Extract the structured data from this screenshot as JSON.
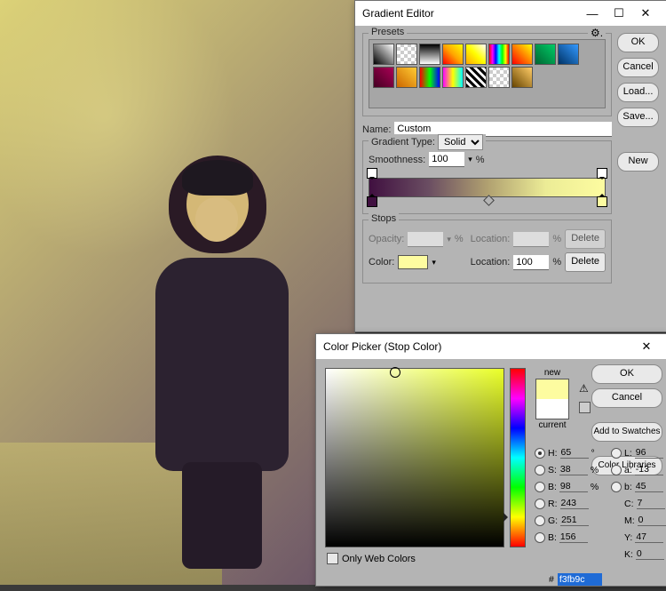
{
  "gradient_editor": {
    "title": "Gradient Editor",
    "buttons": {
      "ok": "OK",
      "cancel": "Cancel",
      "load": "Load...",
      "save": "Save...",
      "new": "New"
    },
    "presets_label": "Presets",
    "name_label": "Name:",
    "name_value": "Custom",
    "type_group": "Gradient Type:",
    "type_value": "Solid",
    "smoothness_label": "Smoothness:",
    "smoothness_value": "100",
    "percent": "%",
    "stops_label": "Stops",
    "opacity_label": "Opacity:",
    "opacity_value": "",
    "location_label": "Location:",
    "location_a": "",
    "location_b": "100",
    "color_label": "Color:",
    "delete": "Delete",
    "gradient_stops": {
      "start_color": "#401040",
      "end_color": "#fdfca0",
      "midpoint_pct": 50
    }
  },
  "color_picker": {
    "title": "Color Picker (Stop Color)",
    "buttons": {
      "ok": "OK",
      "cancel": "Cancel",
      "add": "Add to Swatches",
      "libs": "Color Libraries"
    },
    "new_label": "new",
    "current_label": "current",
    "only_web": "Only Web Colors",
    "hsv": {
      "H": "65",
      "S": "38",
      "B": "98"
    },
    "rgb": {
      "R": "243",
      "G": "251",
      "B": "156"
    },
    "lab": {
      "L": "96",
      "a": "-13",
      "b": "45"
    },
    "cmyk": {
      "C": "7",
      "M": "0",
      "Y": "47",
      "K": "0"
    },
    "deg": "°",
    "pct": "%",
    "hash": "#",
    "hex": "f3fb9c",
    "labels": {
      "H": "H:",
      "S": "S:",
      "Bv": "B:",
      "R": "R:",
      "G": "G:",
      "Bc": "B:",
      "L": "L:",
      "a": "a:",
      "b": "b:",
      "C": "C:",
      "M": "M:",
      "Y": "Y:",
      "K": "K:"
    }
  }
}
